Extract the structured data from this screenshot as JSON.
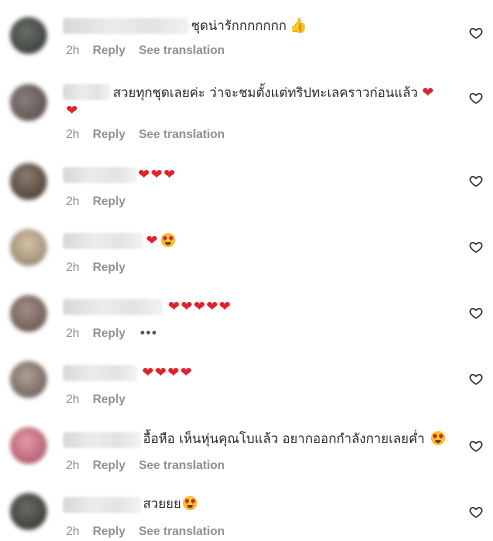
{
  "comments": [
    {
      "text": "ชุดน่ารักกกกกกก",
      "suffix_icon": "thumbs-up-icon",
      "time": "2h",
      "reply": "Reply",
      "translate": "See translation",
      "avatar_color": "#3a3d3a"
    },
    {
      "text": "สวยทุกชุดเลยค่ะ ว่าจะชมตั้งแต่ทริปทะเลคราวก่อนแล้ว",
      "time": "2h",
      "reply": "Reply",
      "translate": "See translation",
      "avatar_color": "#6a5e5c"
    },
    {
      "text": "",
      "hearts": "❤❤❤",
      "time": "2h",
      "reply": "Reply",
      "avatar_color": "#5a4a40"
    },
    {
      "text": "",
      "hearts": "❤",
      "time": "2h",
      "reply": "Reply",
      "avatar_color": "#a88a6e"
    },
    {
      "text": "",
      "hearts": "❤❤❤❤❤",
      "time": "2h",
      "reply": "Reply",
      "more": "•••",
      "avatar_color": "#7a6660"
    },
    {
      "text": "",
      "hearts": "❤❤❤❤",
      "time": "2h",
      "reply": "Reply",
      "avatar_color": "#8a7a70"
    },
    {
      "text": "อื้อหือ เห็นหุ่นคุณโบแล้ว อยากออกกำลังกายเลยค่ำ",
      "time": "2h",
      "reply": "Reply",
      "translate": "See translation",
      "avatar_color": "#c46e80"
    },
    {
      "text": "สวยยย",
      "time": "2h",
      "reply": "Reply",
      "translate": "See translation",
      "avatar_color": "#3c3e3a"
    }
  ],
  "colors": {
    "heart": "#e0212e",
    "meta_text": "#8e8e8e",
    "body_text": "#262626"
  },
  "icons": {
    "like": "heart-outline-icon",
    "emoji": "star-struck-emoji-icon",
    "thumb": "thumbs-up-icon"
  }
}
